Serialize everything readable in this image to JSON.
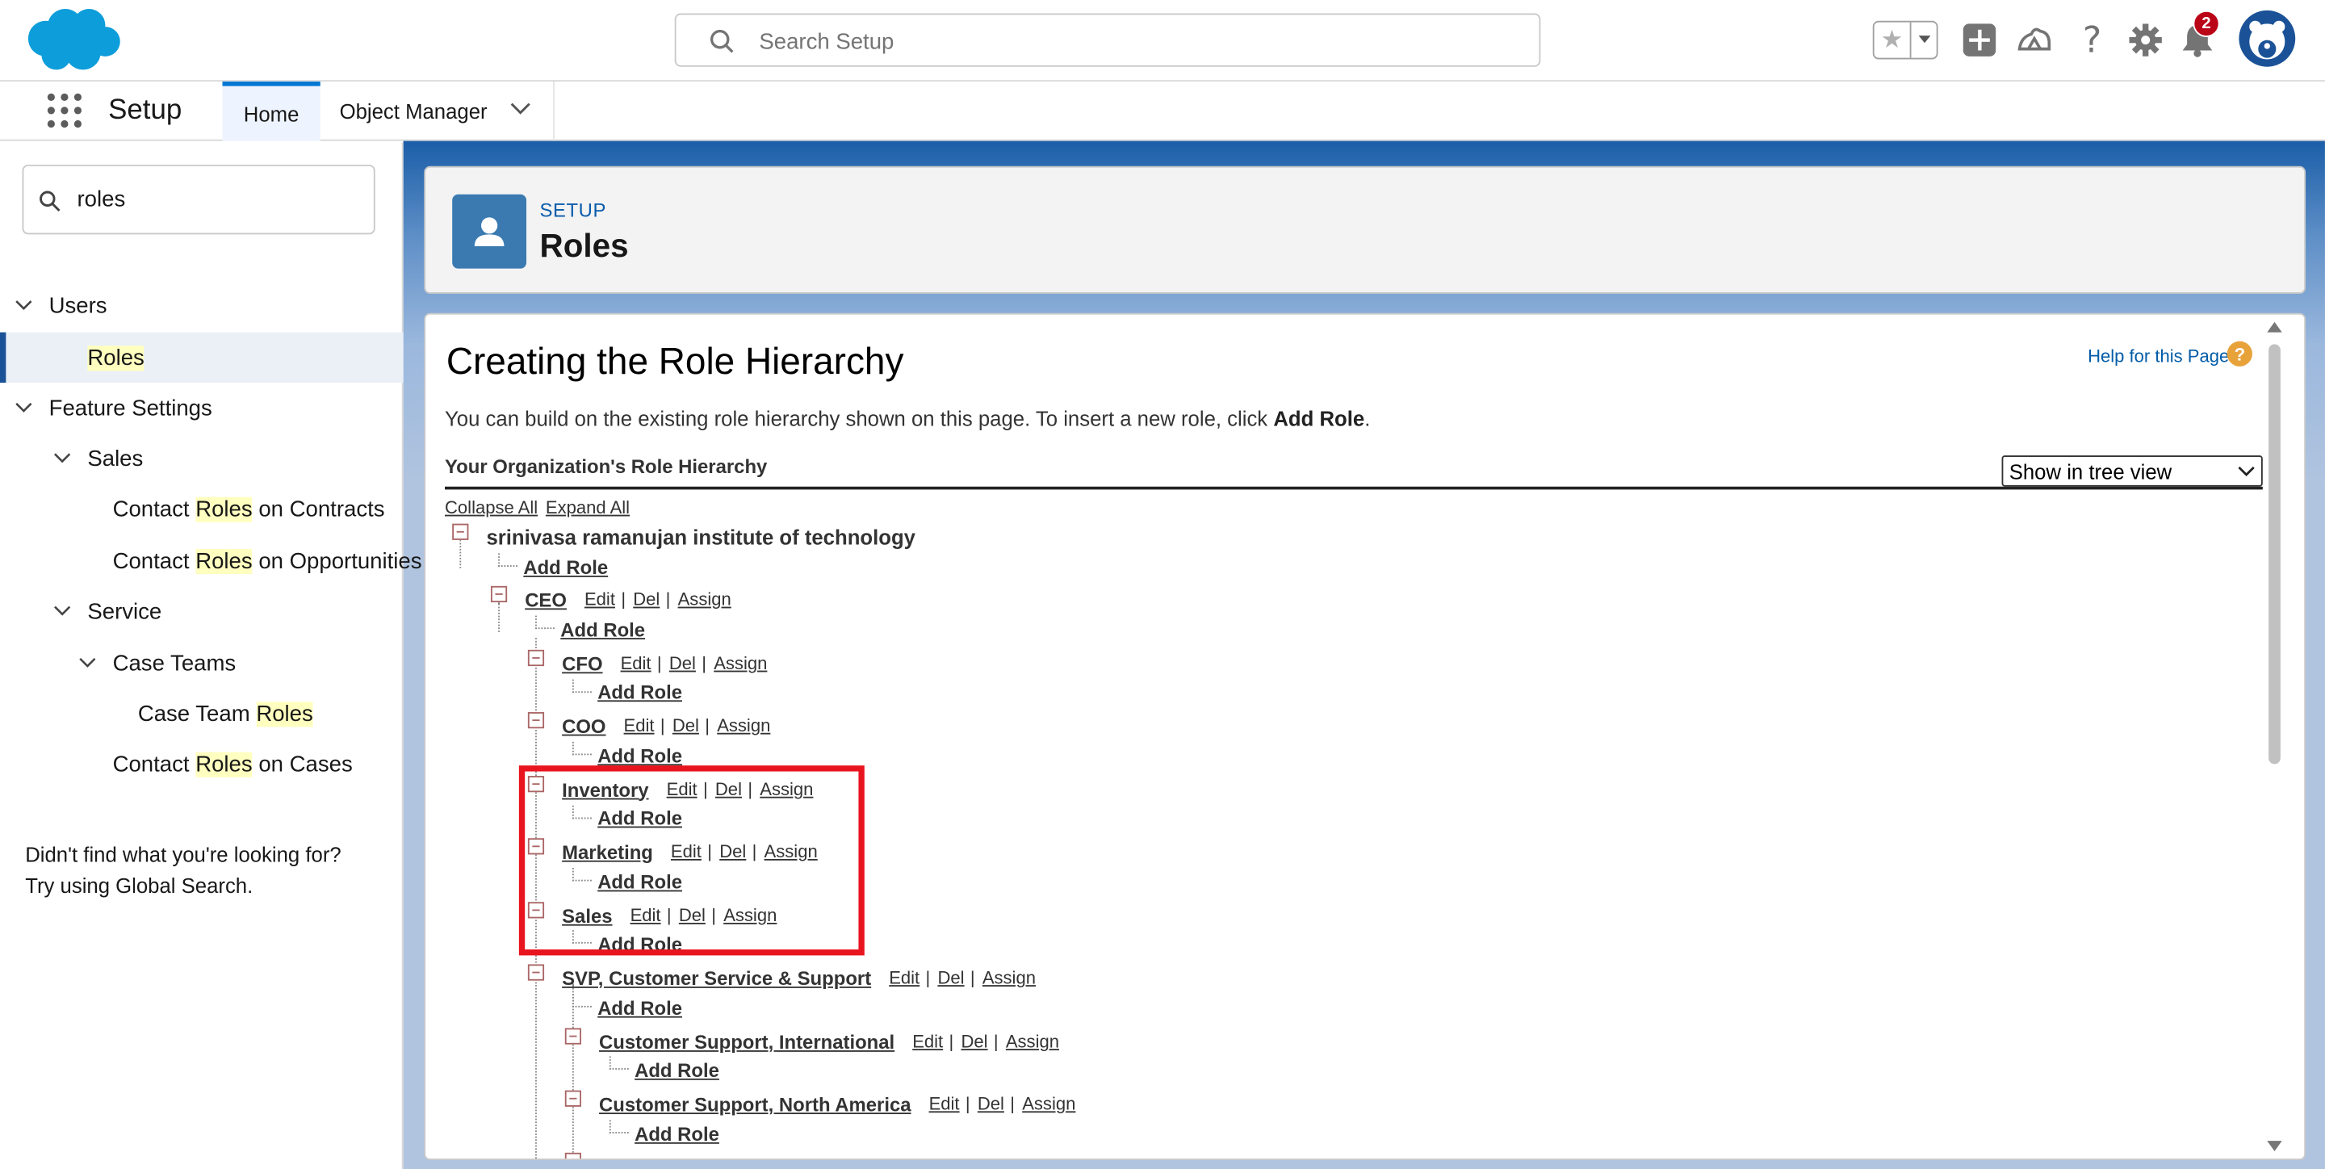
{
  "header": {
    "search_placeholder": "Search Setup",
    "notification_count": "2",
    "icons": [
      "salesforce-cloud-logo",
      "search-icon",
      "star-icon",
      "chevron-down-icon",
      "add-icon",
      "trailhead-icon",
      "help-icon",
      "gear-icon",
      "bell-icon",
      "avatar"
    ]
  },
  "nav": {
    "app_name": "Setup",
    "tabs": [
      {
        "label": "Home",
        "active": true
      },
      {
        "label": "Object Manager",
        "active": false
      }
    ]
  },
  "sidebar": {
    "quick_find_value": "roles",
    "highlight": "Roles",
    "items": [
      {
        "label": "Users"
      },
      {
        "label": "Roles",
        "selected": true
      },
      {
        "label": "Feature Settings"
      },
      {
        "label": "Sales"
      },
      {
        "pre": "Contact ",
        "hl": "Roles",
        "post": " on Contracts"
      },
      {
        "pre": "Contact ",
        "hl": "Roles",
        "post": " on Opportunities"
      },
      {
        "label": "Service"
      },
      {
        "label": "Case Teams"
      },
      {
        "pre": "Case Team ",
        "hl": "Roles",
        "post": ""
      },
      {
        "pre": "Contact ",
        "hl": "Roles",
        "post": " on Cases"
      }
    ],
    "not_found_line1": "Didn't find what you're looking for?",
    "not_found_line2": "Try using Global Search."
  },
  "page_header": {
    "kicker": "SETUP",
    "title": "Roles"
  },
  "content": {
    "title": "Creating the Role Hierarchy",
    "help_link": "Help for this Page",
    "help_icon": "?",
    "intro_text": "You can build on the existing role hierarchy shown on this page. To insert a new role, click ",
    "intro_bold": "Add Role",
    "intro_end": ".",
    "section_title": "Your Organization's Role Hierarchy",
    "view_select": "Show in tree view",
    "collapse_all": "Collapse All",
    "expand_all": "Expand All",
    "org_name": "srinivasa ramanujan institute of technology",
    "add_role_label": "Add Role",
    "actions": {
      "edit": "Edit",
      "del": "Del",
      "assign": "Assign",
      "separator": "|"
    },
    "roles": [
      {
        "name": "CEO"
      },
      {
        "name": "CFO"
      },
      {
        "name": "COO"
      },
      {
        "name": "Inventory"
      },
      {
        "name": "Marketing"
      },
      {
        "name": "Sales"
      },
      {
        "name": "SVP, Customer Service & Support"
      },
      {
        "name": "Customer Support, International"
      },
      {
        "name": "Customer Support, North America"
      }
    ]
  },
  "colors": {
    "brand_blue": "#0176d3",
    "selected_nav_border": "#1b5297",
    "highlight_yellow": "#ffffc0",
    "annotation_red": "#e8141e",
    "notification_red": "#ba0517",
    "help_orange": "#e8a23a"
  }
}
